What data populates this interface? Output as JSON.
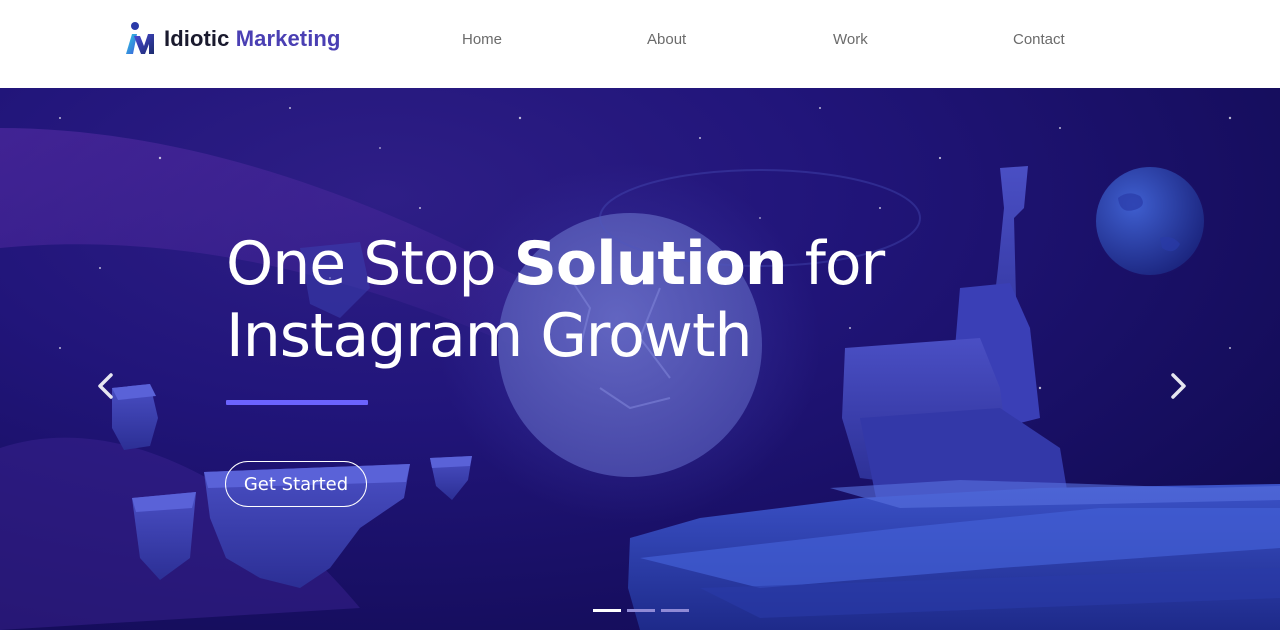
{
  "brand": {
    "name_part1": "Idiotic",
    "name_part2": "Marketing",
    "logo_icon": "im-monogram-logo"
  },
  "nav": {
    "items": [
      {
        "label": "Home"
      },
      {
        "label": "About"
      },
      {
        "label": "Work"
      },
      {
        "label": "Contact"
      }
    ]
  },
  "hero": {
    "title_part1": "One Stop ",
    "title_bold": "Solution",
    "title_part2": " for",
    "title_line2": "Instagram Growth",
    "cta_label": "Get Started",
    "prev_icon": "chevron-left-icon",
    "next_icon": "chevron-right-icon",
    "slides_total": 3,
    "active_slide": 1
  },
  "colors": {
    "brand_accent": "#4a3fb3",
    "divider": "#6c63ff",
    "hero_bg": "#21157a"
  }
}
